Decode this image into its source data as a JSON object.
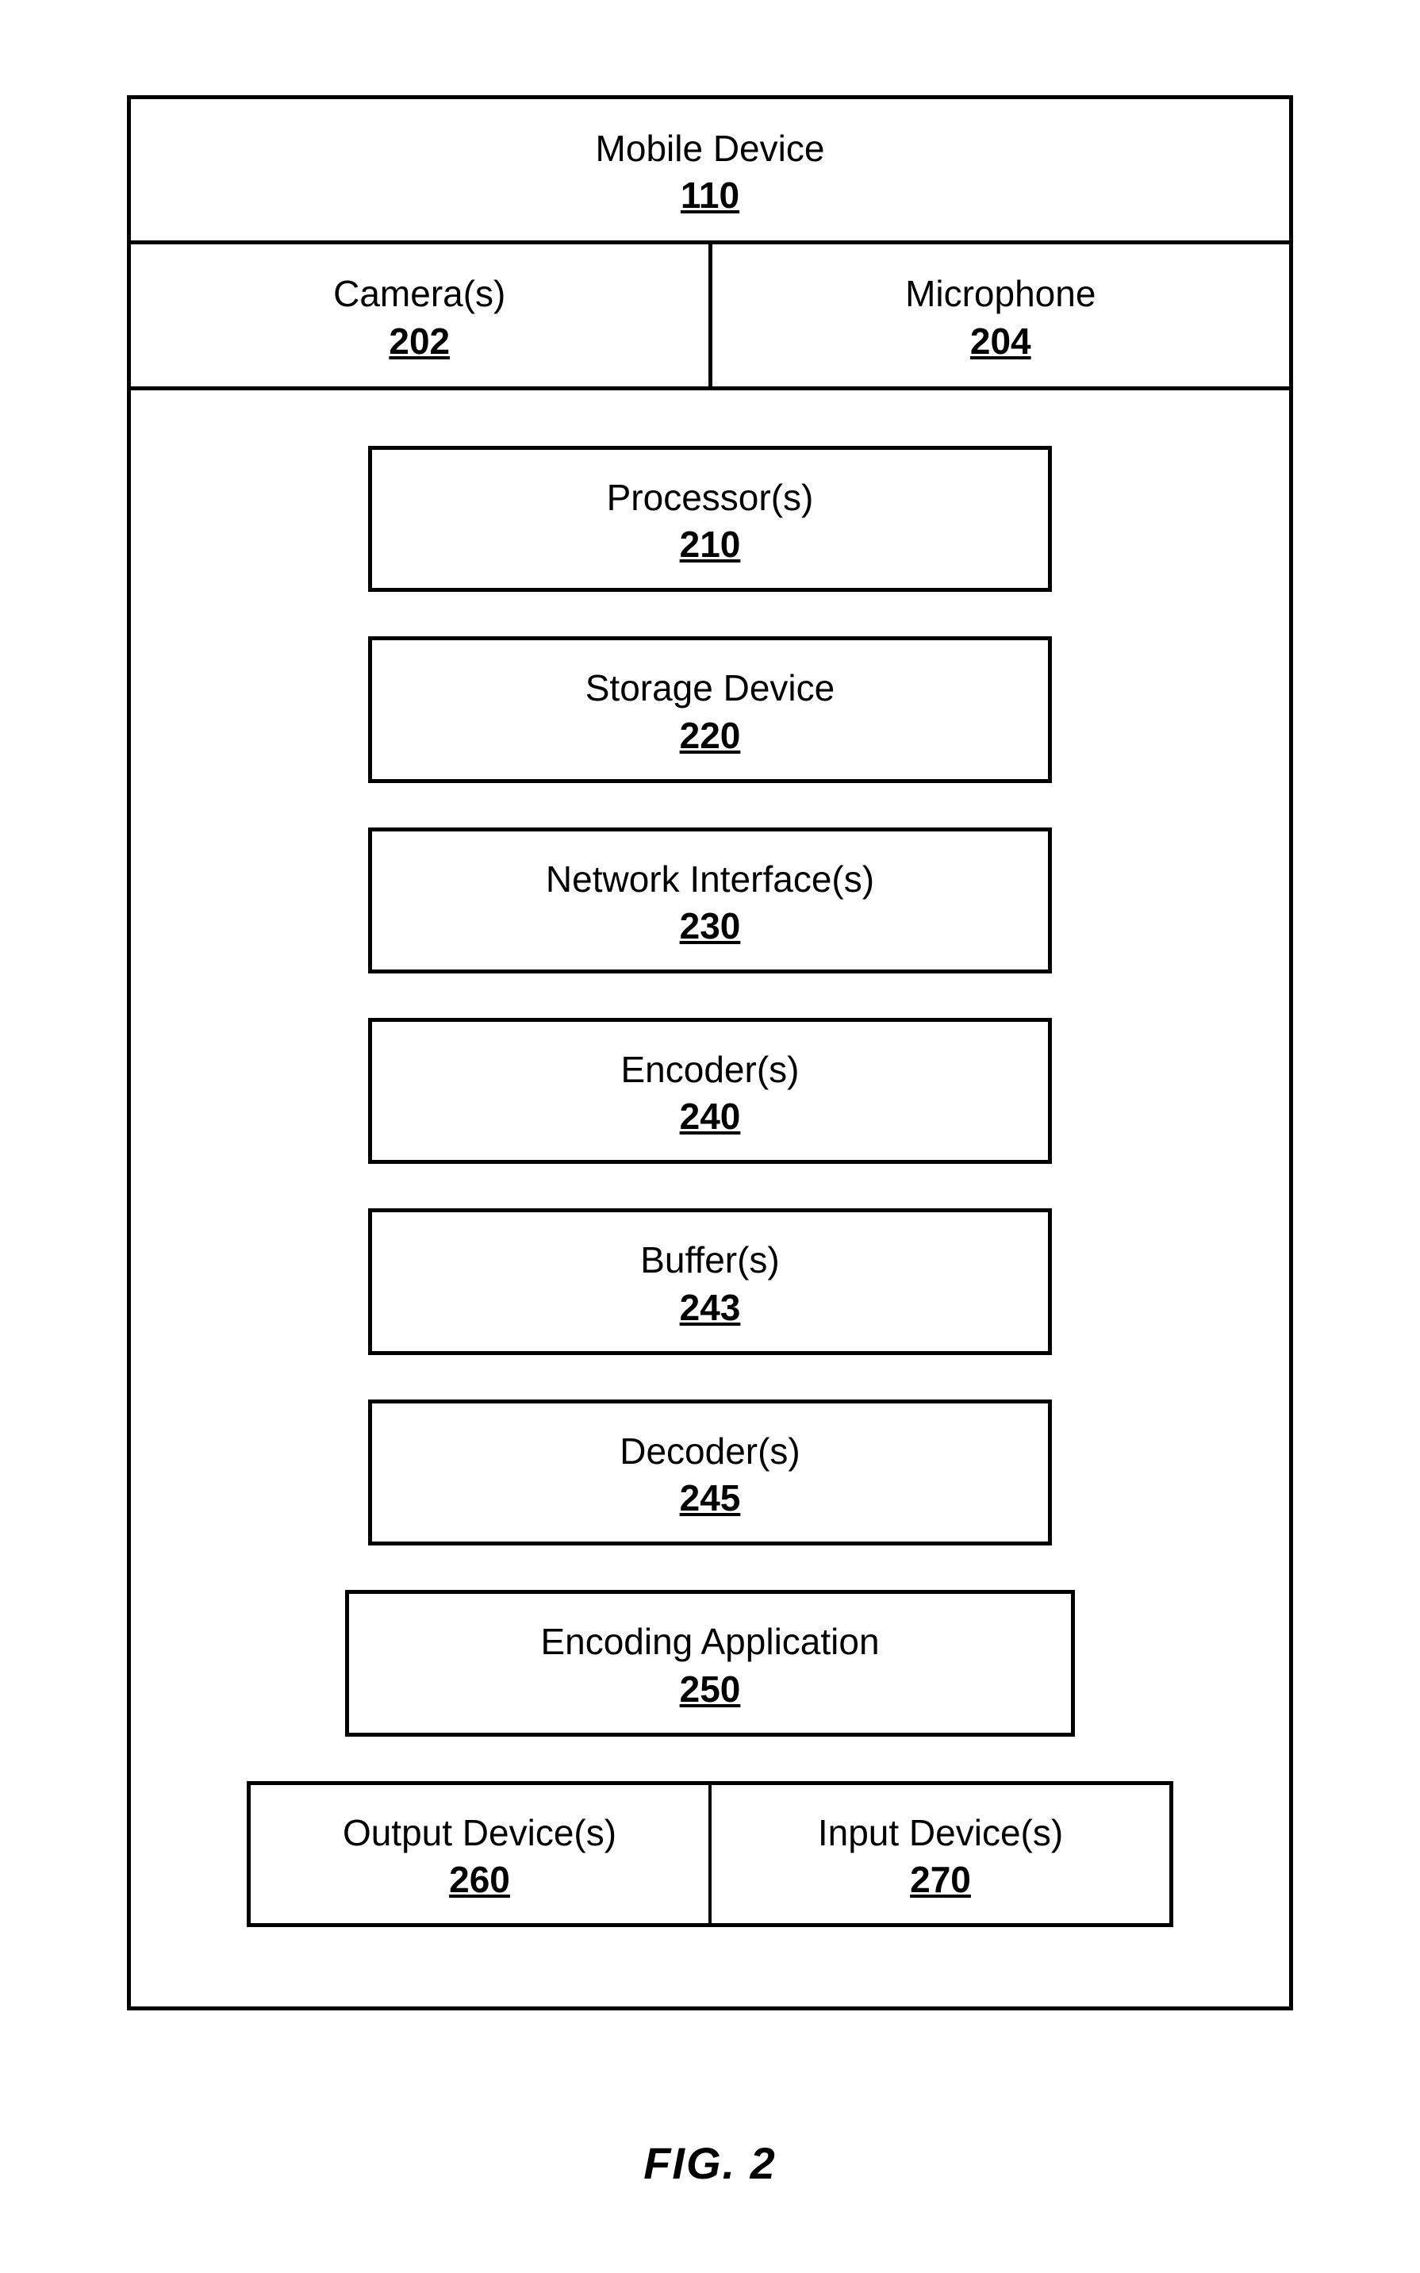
{
  "device": {
    "title": "Mobile Device",
    "ref": "110",
    "top_row": [
      {
        "label": "Camera(s)",
        "ref": "202"
      },
      {
        "label": "Microphone",
        "ref": "204"
      }
    ],
    "blocks": [
      {
        "label": "Processor(s)",
        "ref": "210",
        "wider": false
      },
      {
        "label": "Storage Device",
        "ref": "220",
        "wider": false
      },
      {
        "label": "Network Interface(s)",
        "ref": "230",
        "wider": false
      },
      {
        "label": "Encoder(s)",
        "ref": "240",
        "wider": false
      },
      {
        "label": "Buffer(s)",
        "ref": "243",
        "wider": false
      },
      {
        "label": "Decoder(s)",
        "ref": "245",
        "wider": false
      },
      {
        "label": "Encoding Application",
        "ref": "250",
        "wider": true
      }
    ],
    "io_row": [
      {
        "label": "Output Device(s)",
        "ref": "260"
      },
      {
        "label": "Input Device(s)",
        "ref": "270"
      }
    ]
  },
  "caption": "FIG. 2"
}
